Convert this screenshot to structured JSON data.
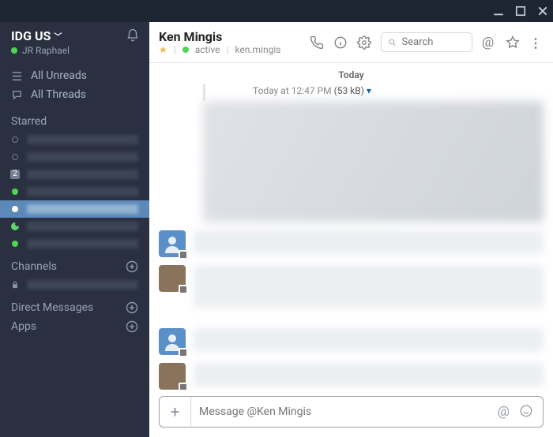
{
  "titlebar": {
    "minimize": "–",
    "maximize": "□",
    "close": "×"
  },
  "workspace": {
    "name": "IDG US",
    "user": "JR Raphael"
  },
  "nav": {
    "unreads": "All Unreads",
    "threads": "All Threads"
  },
  "sections": {
    "starred": "Starred",
    "channels": "Channels",
    "dms": "Direct Messages",
    "apps": "Apps"
  },
  "starred_items": [
    {
      "status": "empty"
    },
    {
      "status": "empty"
    },
    {
      "status": "badge",
      "badge": "2"
    },
    {
      "status": "active"
    },
    {
      "status": "selected"
    },
    {
      "status": "moon"
    },
    {
      "status": "active"
    }
  ],
  "chat": {
    "name": "Ken Mingis",
    "status": "active",
    "handle": "ken.mingis",
    "date_divider": "Today",
    "attachment_time": "Today at 12:47 PM",
    "attachment_size": "(53 kB)"
  },
  "search": {
    "placeholder": "Search"
  },
  "composer": {
    "placeholder": "Message @Ken Mingis"
  }
}
